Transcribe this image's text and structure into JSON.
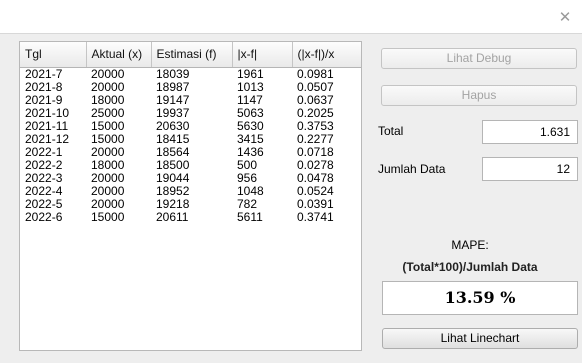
{
  "window": {
    "close_glyph": "✕"
  },
  "table": {
    "headers": [
      "Tgl",
      "Aktual (x)",
      "Estimasi (f)",
      "|x-f|",
      "(|x-f|)/x"
    ],
    "rows": [
      [
        "2021-7",
        "20000",
        "18039",
        "1961",
        "0.0981"
      ],
      [
        "2021-8",
        "20000",
        "18987",
        "1013",
        "0.0507"
      ],
      [
        "2021-9",
        "18000",
        "19147",
        "1147",
        "0.0637"
      ],
      [
        "2021-10",
        "25000",
        "19937",
        "5063",
        "0.2025"
      ],
      [
        "2021-11",
        "15000",
        "20630",
        "5630",
        "0.3753"
      ],
      [
        "2021-12",
        "15000",
        "18415",
        "3415",
        "0.2277"
      ],
      [
        "2022-1",
        "20000",
        "18564",
        "1436",
        "0.0718"
      ],
      [
        "2022-2",
        "18000",
        "18500",
        "500",
        "0.0278"
      ],
      [
        "2022-3",
        "20000",
        "19044",
        "956",
        "0.0478"
      ],
      [
        "2022-4",
        "20000",
        "18952",
        "1048",
        "0.0524"
      ],
      [
        "2022-5",
        "20000",
        "19218",
        "782",
        "0.0391"
      ],
      [
        "2022-6",
        "15000",
        "20611",
        "5611",
        "0.3741"
      ]
    ]
  },
  "panel": {
    "debug_button": "Lihat Debug",
    "delete_button": "Hapus",
    "total_label": "Total",
    "total_value": "1.631",
    "count_label": "Jumlah Data",
    "count_value": "12",
    "mape_title": "MAPE:",
    "mape_formula": "(Total*100)/Jumlah Data",
    "mape_result": "13.59 %",
    "linechart_button": "Lihat Linechart"
  }
}
